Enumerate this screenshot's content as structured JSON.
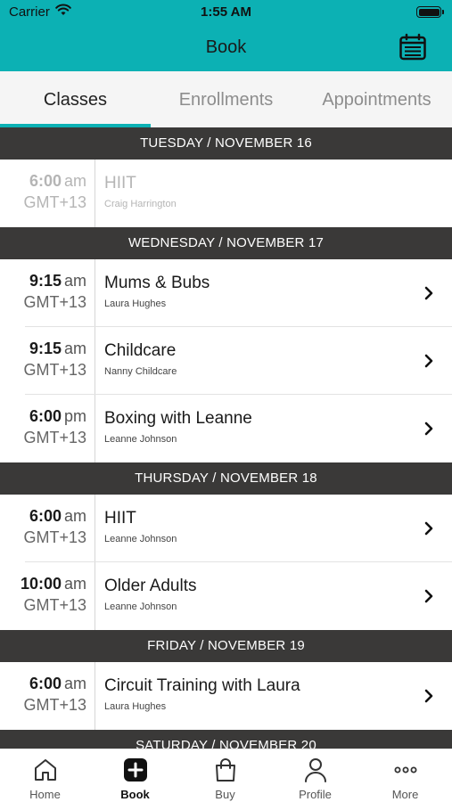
{
  "status_bar": {
    "carrier": "Carrier",
    "time": "1:55 AM"
  },
  "nav": {
    "title": "Book"
  },
  "tabs": [
    {
      "label": "Classes",
      "active": true
    },
    {
      "label": "Enrollments",
      "active": false
    },
    {
      "label": "Appointments",
      "active": false
    }
  ],
  "days": [
    {
      "header": "TUESDAY / NOVEMBER 16",
      "classes": [
        {
          "time": "6:00",
          "ampm": "am",
          "tz": "GMT+13",
          "name": "HIIT",
          "instructor": "Craig Harrington",
          "past": true
        }
      ]
    },
    {
      "header": "WEDNESDAY / NOVEMBER 17",
      "classes": [
        {
          "time": "9:15",
          "ampm": "am",
          "tz": "GMT+13",
          "name": "Mums & Bubs",
          "instructor": "Laura Hughes",
          "past": false
        },
        {
          "time": "9:15",
          "ampm": "am",
          "tz": "GMT+13",
          "name": "Childcare",
          "instructor": "Nanny Childcare",
          "past": false
        },
        {
          "time": "6:00",
          "ampm": "pm",
          "tz": "GMT+13",
          "name": "Boxing with Leanne",
          "instructor": "Leanne Johnson",
          "past": false
        }
      ]
    },
    {
      "header": "THURSDAY / NOVEMBER 18",
      "classes": [
        {
          "time": "6:00",
          "ampm": "am",
          "tz": "GMT+13",
          "name": "HIIT",
          "instructor": "Leanne Johnson",
          "past": false
        },
        {
          "time": "10:00",
          "ampm": "am",
          "tz": "GMT+13",
          "name": "Older Adults",
          "instructor": "Leanne Johnson",
          "past": false
        }
      ]
    },
    {
      "header": "FRIDAY / NOVEMBER 19",
      "classes": [
        {
          "time": "6:00",
          "ampm": "am",
          "tz": "GMT+13",
          "name": "Circuit Training with Laura",
          "instructor": "Laura Hughes",
          "past": false
        }
      ]
    },
    {
      "header": "SATURDAY / NOVEMBER 20",
      "classes": []
    }
  ],
  "tab_bar": [
    {
      "label": "Home",
      "icon": "home-icon",
      "active": false
    },
    {
      "label": "Book",
      "icon": "book-plus-icon",
      "active": true
    },
    {
      "label": "Buy",
      "icon": "shopping-bag-icon",
      "active": false
    },
    {
      "label": "Profile",
      "icon": "profile-icon",
      "active": false
    },
    {
      "label": "More",
      "icon": "more-icon",
      "active": false
    }
  ],
  "colors": {
    "accent": "#0cb1b4",
    "day_header_bg": "#3a3938"
  }
}
